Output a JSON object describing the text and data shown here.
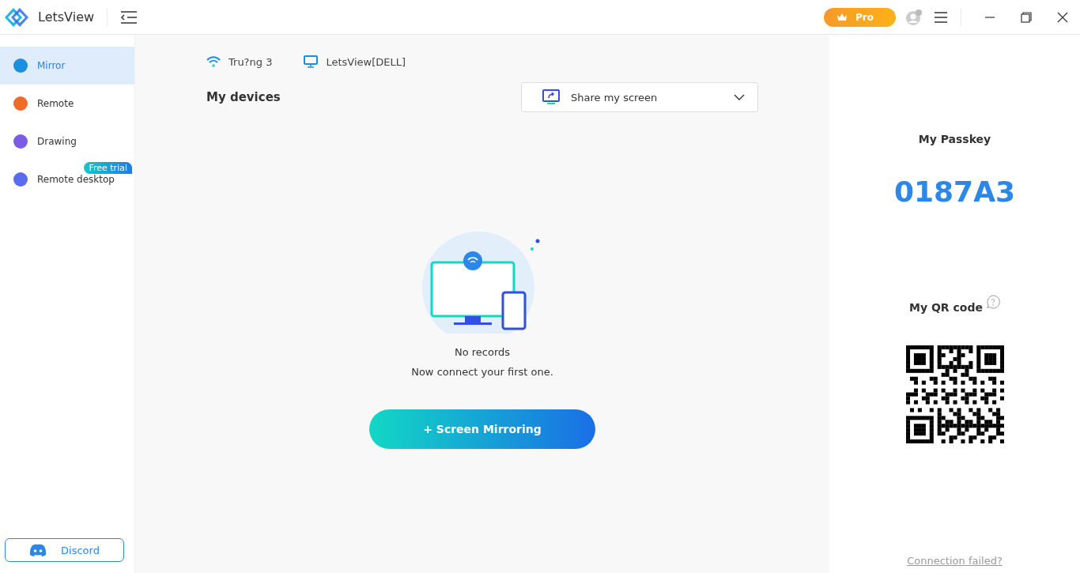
{
  "app": {
    "name": "LetsView"
  },
  "top_bar": {
    "pro_label": "Pro"
  },
  "sidebar": {
    "items": [
      {
        "label": "Mirror",
        "selected": true,
        "color": "#1a8fe0"
      },
      {
        "label": "Remote",
        "selected": false,
        "color": "#f06a2a"
      },
      {
        "label": "Drawing",
        "selected": false,
        "color": "#7c5ce6"
      },
      {
        "label": "Remote desktop",
        "selected": false,
        "color": "#5a6cf0",
        "badge": "Free trial"
      }
    ],
    "discord": "Discord"
  },
  "connection": {
    "wifi": "Tru?ng 3",
    "device": "LetsView[DELL]"
  },
  "devices": {
    "title": "My devices",
    "share": "Share my screen",
    "empty_title": "No records",
    "empty_text": "Now connect your first one.",
    "button": "+ Screen Mirroring"
  },
  "right_panel": {
    "passkey_label": "My Passkey",
    "passkey": "0187A3",
    "qr_label": "My QR code",
    "help_link": "Connection failed?"
  }
}
